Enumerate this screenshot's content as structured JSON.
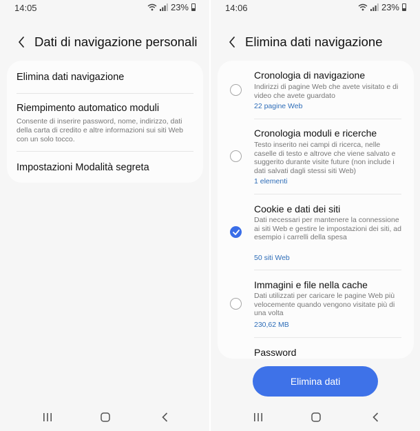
{
  "left_screen": {
    "status": {
      "time": "14:05",
      "battery": "23%"
    },
    "header": {
      "title": "Dati di navigazione personali"
    },
    "items": [
      {
        "label": "Elimina dati navigazione"
      },
      {
        "label": "Riempimento automatico moduli",
        "description": "Consente di inserire password, nome, indirizzo, dati della carta di credito e altre informazioni sui siti Web con un solo tocco."
      },
      {
        "label": "Impostazioni Modalità segreta"
      }
    ]
  },
  "right_screen": {
    "status": {
      "time": "14:06",
      "battery": "23%"
    },
    "header": {
      "title": "Elimina dati navigazione"
    },
    "options": [
      {
        "title": "Cronologia di navigazione",
        "description": "Indirizzi di pagine Web che avete visitato e di video che avete guardato",
        "count": "22 pagine Web",
        "checked": false
      },
      {
        "title": "Cronologia moduli e ricerche",
        "description": "Testo inserito nei campi di ricerca, nelle caselle di testo e altrove che viene salvato e suggerito durante visite future (non include i dati salvati dagli stessi siti Web)",
        "count": "1 elementi",
        "checked": false
      },
      {
        "title": "Cookie e dati dei siti",
        "description": "Dati necessari per mantenere la connessione ai siti Web e gestire le impostazioni dei siti, ad esempio i carrelli della spesa",
        "count": "50 siti Web",
        "checked": true
      },
      {
        "title": "Immagini e file nella cache",
        "description": "Dati utilizzati per caricare le pagine Web più velocemente quando vengono visitate più di una volta",
        "count": "230,62 MB",
        "checked": false
      },
      {
        "title": "Password"
      }
    ],
    "button": {
      "label": "Elimina dati"
    }
  },
  "colors": {
    "accent": "#3e72e8",
    "link": "#2e6db8",
    "background": "#f6f6f6",
    "card": "#fcfcfc"
  },
  "icons": {
    "wifi": "wifi-icon",
    "signal": "signal-icon",
    "battery": "battery-icon",
    "back": "chevron-left-icon",
    "recents": "recents-icon",
    "home": "home-icon",
    "nav_back": "nav-back-icon",
    "check": "check-icon"
  }
}
